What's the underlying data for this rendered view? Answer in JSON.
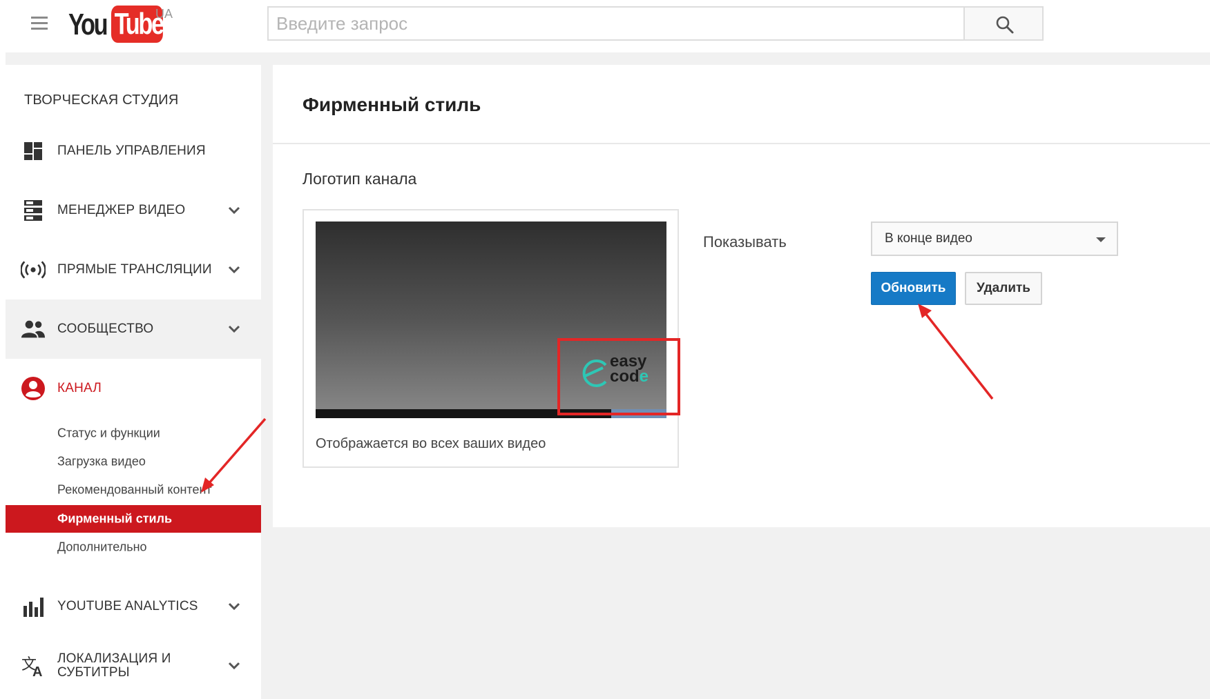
{
  "header": {
    "logo_you": "You",
    "logo_tube": "Tube",
    "logo_region": "UA",
    "search_placeholder": "Введите запрос"
  },
  "sidebar": {
    "studio_title": "ТВОРЧЕСКАЯ СТУДИЯ",
    "items": [
      {
        "label": "ПАНЕЛЬ УПРАВЛЕНИЯ",
        "icon": "dashboard-icon"
      },
      {
        "label": "МЕНЕДЖЕР ВИДЕО",
        "icon": "video-manager-icon"
      },
      {
        "label": "ПРЯМЫЕ ТРАНСЛЯЦИИ",
        "icon": "live-broadcast-icon"
      },
      {
        "label": "СООБЩЕСТВО",
        "icon": "community-icon"
      },
      {
        "label": "КАНАЛ",
        "icon": "channel-icon"
      },
      {
        "label": "YOUTUBE ANALYTICS",
        "icon": "analytics-icon"
      },
      {
        "label": "ЛОКАЛИЗАЦИЯ И СУБТИТРЫ",
        "icon": "translate-icon"
      }
    ],
    "channel_subitems": [
      {
        "label": "Статус и функции"
      },
      {
        "label": "Загрузка видео"
      },
      {
        "label": "Рекомендованный контент"
      },
      {
        "label": "Фирменный стиль"
      },
      {
        "label": "Дополнительно"
      }
    ]
  },
  "content": {
    "page_title": "Фирменный стиль",
    "section_title": "Логотип канала",
    "preview_caption": "Отображается во всех ваших видео",
    "watermark_line1": "easy",
    "watermark_line2_main": "cod",
    "watermark_line2_accent": "e",
    "show_label": "Показывать",
    "show_selected": "В конце видео",
    "update_button": "Обновить",
    "delete_button": "Удалить"
  },
  "colors": {
    "brand_red": "#cc181e",
    "button_blue": "#167ac6",
    "annotation_red": "#e32626",
    "watermark_accent": "#2ec7b5"
  }
}
